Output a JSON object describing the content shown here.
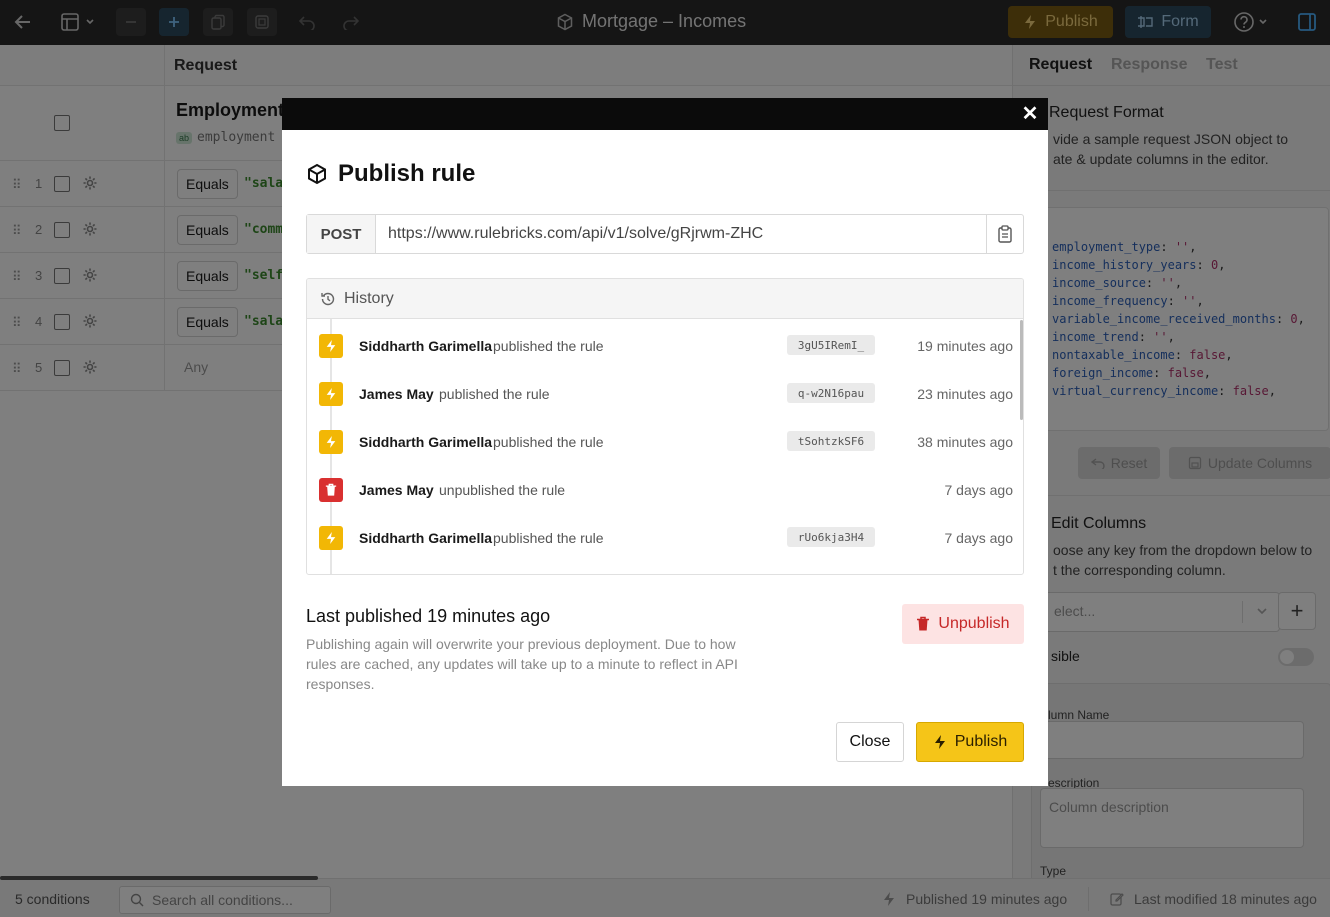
{
  "toolbar": {
    "title": "Mortgage – Incomes",
    "publish_label": "Publish",
    "form_label": "Form"
  },
  "editor": {
    "header_label": "Request",
    "column": {
      "title": "Employment",
      "key": "employment",
      "type_badge": "ab"
    },
    "rows": [
      {
        "num": "1",
        "operator": "Equals",
        "value": "\"sala"
      },
      {
        "num": "2",
        "operator": "Equals",
        "value": "\"comm"
      },
      {
        "num": "3",
        "operator": "Equals",
        "value": "\"self"
      },
      {
        "num": "4",
        "operator": "Equals",
        "value": "\"sala"
      },
      {
        "num": "5",
        "any": "Any"
      }
    ]
  },
  "right_panel": {
    "tabs": [
      "Request",
      "Response",
      "Test"
    ],
    "request_format_title": "Request Format",
    "request_format_desc_1": "vide a sample request JSON object to",
    "request_format_desc_2": "ate & update columns in the editor.",
    "code_lines": [
      {
        "key": "employment_type",
        "val": "''"
      },
      {
        "key": "income_history_years",
        "val": "0"
      },
      {
        "key": "income_source",
        "val": "''"
      },
      {
        "key": "income_frequency",
        "val": "''"
      },
      {
        "key": "variable_income_received_months",
        "val": "0"
      },
      {
        "key": "income_trend",
        "val": "''"
      },
      {
        "key": "nontaxable_income",
        "val": "false"
      },
      {
        "key": "foreign_income",
        "val": "false"
      },
      {
        "key": "virtual_currency_income",
        "val": "false"
      }
    ],
    "reset_label": "Reset",
    "update_columns_label": "Update Columns",
    "edit_columns_title": "Edit Columns",
    "edit_columns_desc_1": "oose any key from the dropdown below to",
    "edit_columns_desc_2": "t the corresponding column.",
    "select_placeholder": "elect...",
    "visible_label": "sible",
    "column_name_label": "lumn Name",
    "description_label": "escription",
    "description_placeholder": "Column description",
    "type_label": "Type"
  },
  "statusbar": {
    "conditions": "5 conditions",
    "search_placeholder": "Search all conditions...",
    "published": "Published 19 minutes ago",
    "modified": "Last modified 18 minutes ago"
  },
  "modal": {
    "title": "Publish rule",
    "method": "POST",
    "url": "https://www.rulebricks.com/api/v1/solve/gRjrwm-ZHC",
    "history_title": "History",
    "history": [
      {
        "type": "publish",
        "user": "Siddharth Garimella",
        "action": "published the rule",
        "hash": "3gU5IRemI_",
        "time": "19 minutes ago"
      },
      {
        "type": "publish",
        "user": "James May",
        "action": "published the rule",
        "hash": "q-w2N16pau",
        "time": "23 minutes ago"
      },
      {
        "type": "publish",
        "user": "Siddharth Garimella",
        "action": "published the rule",
        "hash": "tSohtzkSF6",
        "time": "38 minutes ago"
      },
      {
        "type": "unpublish",
        "user": "James May",
        "action": "unpublished the rule",
        "hash": "",
        "time": "7 days ago"
      },
      {
        "type": "publish",
        "user": "Siddharth Garimella",
        "action": "published the rule",
        "hash": "rUo6kja3H4",
        "time": "7 days ago"
      }
    ],
    "last_published": "Last published 19 minutes ago",
    "last_desc": "Publishing again will overwrite your previous deployment. Due to how rules are cached, any updates will take up to a minute to reflect in API responses.",
    "unpublish_label": "Unpublish",
    "close_label": "Close",
    "publish_label": "Publish"
  }
}
